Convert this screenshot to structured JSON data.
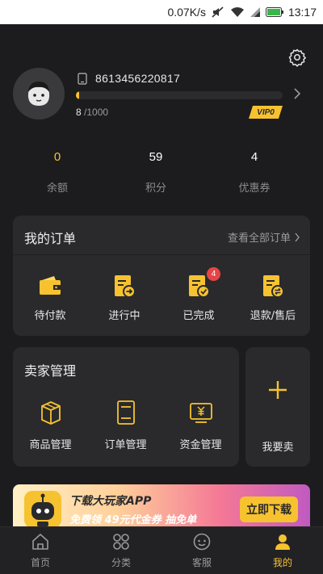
{
  "status_bar": {
    "speed": "0.07K/s",
    "time": "13:17"
  },
  "profile": {
    "phone": "8613456220817",
    "progress_current": "8",
    "progress_total": " /1000",
    "progress_fraction": 0.008,
    "vip_label": "VIP0"
  },
  "stats": [
    {
      "value": "0",
      "label": "余额"
    },
    {
      "value": "59",
      "label": "积分"
    },
    {
      "value": "4",
      "label": "优惠券"
    }
  ],
  "orders": {
    "title": "我的订单",
    "view_all": "查看全部订单",
    "items": [
      {
        "label": "待付款",
        "icon": "wallet-icon"
      },
      {
        "label": "进行中",
        "icon": "document-arrow-icon"
      },
      {
        "label": "已完成",
        "icon": "document-check-icon",
        "badge": "4"
      },
      {
        "label": "退款/售后",
        "icon": "refund-document-icon"
      }
    ]
  },
  "seller": {
    "title": "卖家管理",
    "items": [
      {
        "label": "商品管理",
        "icon": "box-icon"
      },
      {
        "label": "订单管理",
        "icon": "order-list-icon"
      },
      {
        "label": "资金管理",
        "icon": "money-icon"
      }
    ],
    "sell_label": "我要卖"
  },
  "banner": {
    "title": "下载大玩家APP",
    "subtitle": "免费领 49元代金券 抽免单",
    "button": "立即下载"
  },
  "tabs": [
    {
      "label": "首页",
      "icon": "home-icon"
    },
    {
      "label": "分类",
      "icon": "category-icon"
    },
    {
      "label": "客服",
      "icon": "customer-service-icon"
    },
    {
      "label": "我的",
      "icon": "user-icon",
      "active": true
    }
  ],
  "colors": {
    "accent": "#f7c230",
    "background": "#1c1c1e",
    "card": "#2a2a2c",
    "badge": "#e54545"
  }
}
